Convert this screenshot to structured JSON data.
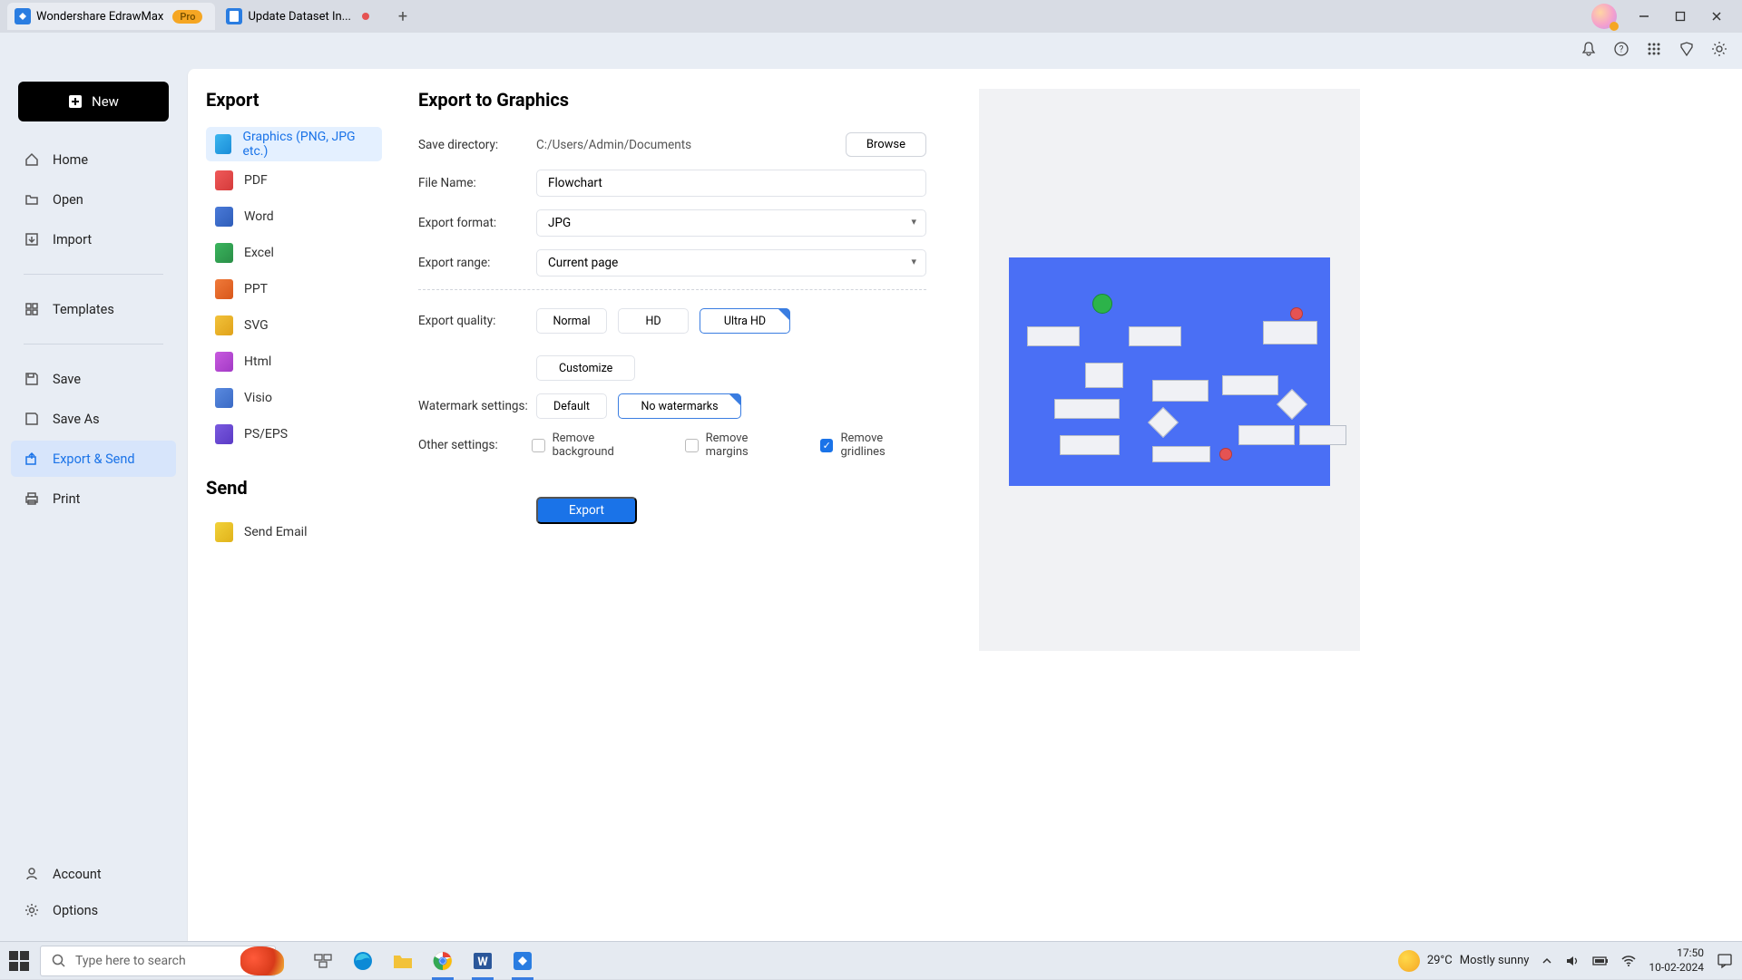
{
  "title_bar": {
    "tab1": "Wondershare EdrawMax",
    "pro_badge": "Pro",
    "tab2": "Update Dataset In..."
  },
  "new_btn": "New",
  "nav": {
    "home": "Home",
    "open": "Open",
    "import": "Import",
    "templates": "Templates",
    "save": "Save",
    "save_as": "Save As",
    "export_send": "Export & Send",
    "print": "Print",
    "account": "Account",
    "options": "Options"
  },
  "export_col": {
    "title": "Export",
    "graphics": "Graphics (PNG, JPG etc.)",
    "pdf": "PDF",
    "word": "Word",
    "excel": "Excel",
    "ppt": "PPT",
    "svg": "SVG",
    "html": "Html",
    "visio": "Visio",
    "pseps": "PS/EPS",
    "send_title": "Send",
    "send_email": "Send Email"
  },
  "form": {
    "title": "Export to Graphics",
    "save_dir_label": "Save directory:",
    "save_dir_val": "C:/Users/Admin/Documents",
    "browse": "Browse",
    "file_name_label": "File Name:",
    "file_name_val": "Flowchart",
    "export_format_label": "Export format:",
    "export_format_val": "JPG",
    "export_range_label": "Export range:",
    "export_range_val": "Current page",
    "export_quality_label": "Export quality:",
    "quality_normal": "Normal",
    "quality_hd": "HD",
    "quality_ultra": "Ultra HD",
    "customize": "Customize",
    "watermark_label": "Watermark settings:",
    "watermark_default": "Default",
    "watermark_none": "No watermarks",
    "other_label": "Other settings:",
    "remove_bg": "Remove background",
    "remove_margins": "Remove margins",
    "remove_gridlines": "Remove gridlines",
    "export_btn": "Export"
  },
  "taskbar": {
    "search_placeholder": "Type here to search",
    "weather_temp": "29°C",
    "weather_desc": "Mostly sunny",
    "time": "17:50",
    "date": "10-02-2024"
  }
}
